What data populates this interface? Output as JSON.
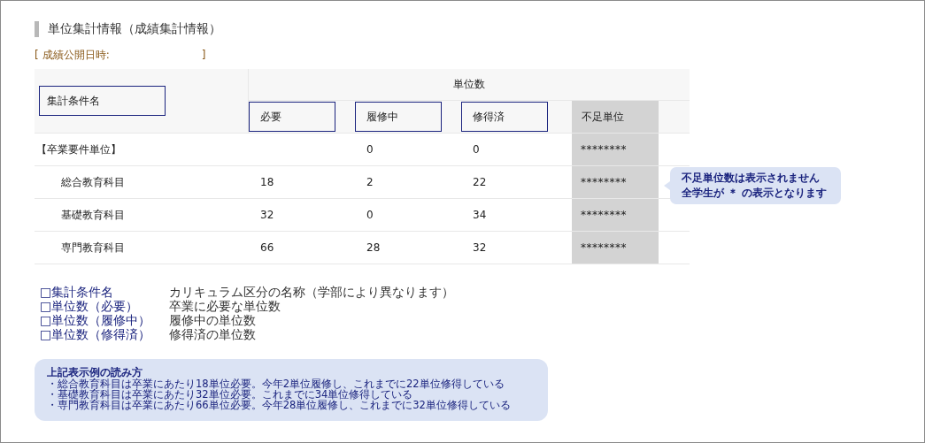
{
  "section_title": "単位集計情報（成績集計情報）",
  "publish_date": {
    "open": "[",
    "label": "成績公開日時:",
    "close": "]"
  },
  "table": {
    "name_header": {
      "label": "集計条件名",
      "boxed": true
    },
    "group_header": "単位数",
    "columns": [
      {
        "label": "必要",
        "boxed": true,
        "shaded": false
      },
      {
        "label": "履修中",
        "boxed": true,
        "shaded": false
      },
      {
        "label": "修得済",
        "boxed": true,
        "shaded": false
      },
      {
        "label": "不足単位",
        "boxed": false,
        "shaded": true
      }
    ],
    "rows": [
      {
        "name": "【卒業要件単位】",
        "cells": [
          "",
          "0",
          "0",
          "********"
        ],
        "children": [
          {
            "name": "総合教育科目",
            "cells": [
              "18",
              "2",
              "22",
              "********"
            ]
          },
          {
            "name": "基礎教育科目",
            "cells": [
              "32",
              "0",
              "34",
              "********"
            ]
          },
          {
            "name": "専門教育科目",
            "cells": [
              "66",
              "28",
              "32",
              "********"
            ]
          }
        ]
      }
    ]
  },
  "callout": [
    "不足単位数は表示されません",
    "全学生が ＊ の表示となります"
  ],
  "legend": [
    {
      "term": "□集計条件名",
      "desc": "カリキュラム区分の名称（学部により異なります）"
    },
    {
      "term": "□単位数（必要）",
      "desc": "卒業に必要な単位数"
    },
    {
      "term": "□単位数（履修中）",
      "desc": "履修中の単位数"
    },
    {
      "term": "□単位数（修得済）",
      "desc": "修得済の単位数"
    }
  ],
  "example": {
    "title": "上記表示例の読み方",
    "lines": [
      "・総合教育科目は卒業にあたり18単位必要。今年2単位履修し、これまでに22単位修得している",
      "・基礎教育科目は卒業にあたり32単位必要。これまでに34単位修得している",
      "・専門教育科目は卒業にあたり66単位必要。今年28単位履修し、これまでに32単位修得している"
    ]
  }
}
